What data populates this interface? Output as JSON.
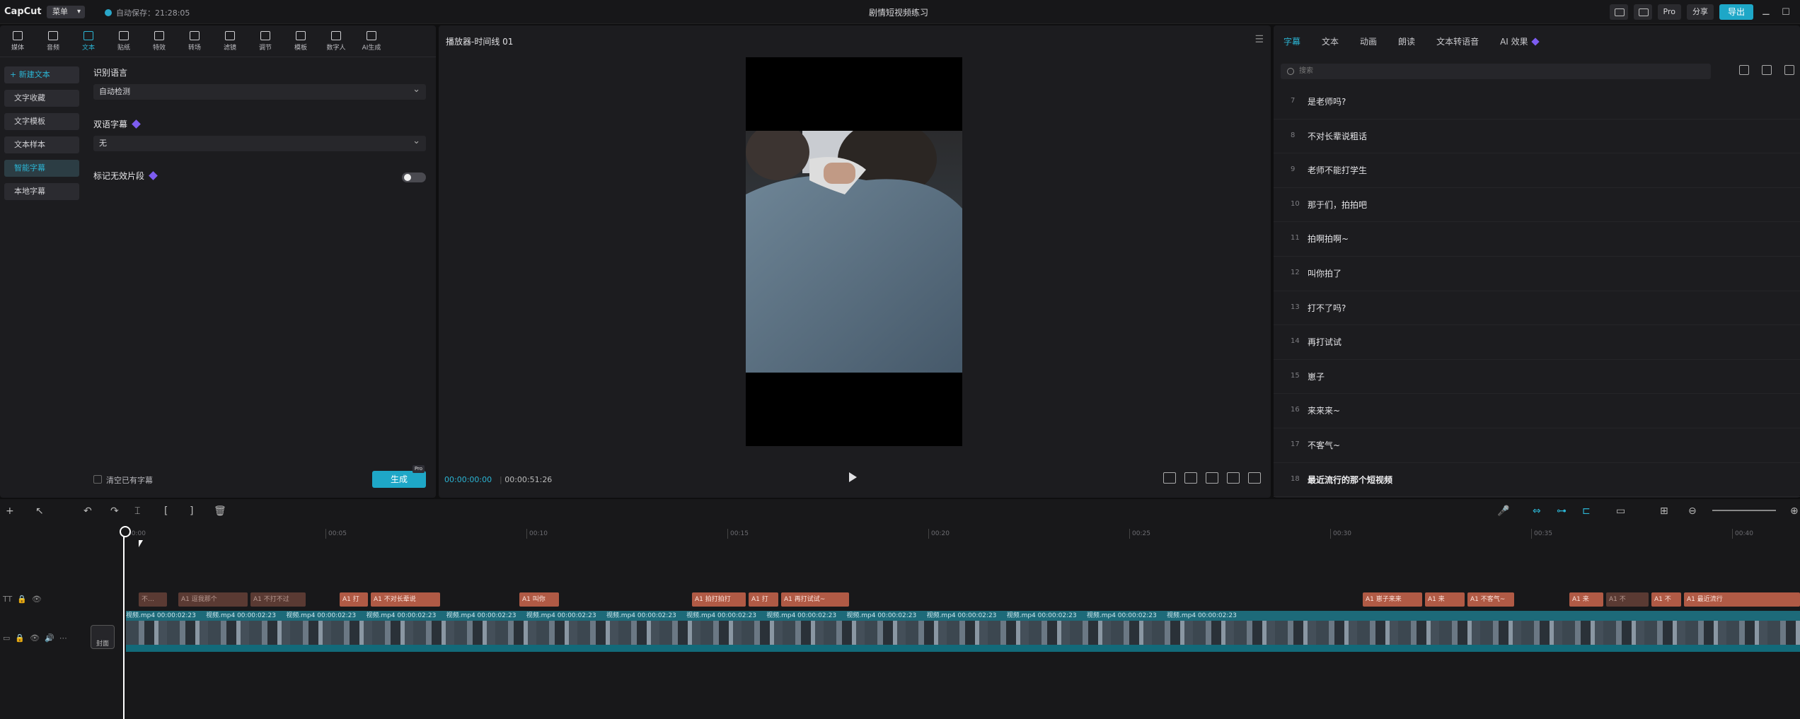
{
  "titlebar": {
    "logo": "CapCut",
    "menu": "菜单",
    "save_status": "自动保存：21:28:05",
    "project_title": "剧情短视频练习",
    "pro_label": "Pro",
    "share_label": "分享",
    "export_label": "导出"
  },
  "toolbar": {
    "tools": [
      {
        "label": "媒体"
      },
      {
        "label": "音频"
      },
      {
        "label": "文本"
      },
      {
        "label": "贴纸"
      },
      {
        "label": "特效"
      },
      {
        "label": "转场"
      },
      {
        "label": "滤镜"
      },
      {
        "label": "调节"
      },
      {
        "label": "模板"
      },
      {
        "label": "数字人"
      },
      {
        "label": "AI生成"
      }
    ]
  },
  "left_panel": {
    "side_items": [
      "+ 新建文本",
      "文字收藏",
      "文字模板",
      "文本样本",
      "智能字幕",
      "本地字幕"
    ],
    "recognize_language_label": "识别语言",
    "recognize_language_value": "自动检测",
    "bilingual_label": "双语字幕",
    "bilingual_value": "无",
    "mark_invalid_label": "标记无效片段",
    "clear_label": "清空已有字幕",
    "generate_label": "生成",
    "generate_badge": "Pro"
  },
  "player": {
    "title": "播放器-时间线 01",
    "time_current": "00:00:00:00",
    "time_total": "00:00:51:26"
  },
  "right_panel": {
    "tabs": [
      "字幕",
      "文本",
      "动画",
      "朗读",
      "文本转语音",
      "AI 效果"
    ],
    "search_placeholder": "搜索",
    "captions": [
      {
        "num": "7",
        "text": "是老师吗?"
      },
      {
        "num": "8",
        "text": "不对长辈说粗话"
      },
      {
        "num": "9",
        "text": "老师不能打学生"
      },
      {
        "num": "10",
        "text": "那于们，拍拍吧"
      },
      {
        "num": "11",
        "text": "拍啊拍啊~"
      },
      {
        "num": "12",
        "text": "叫你拍了"
      },
      {
        "num": "13",
        "text": "打不了吗?"
      },
      {
        "num": "14",
        "text": "再打试试"
      },
      {
        "num": "15",
        "text": "崽子"
      },
      {
        "num": "16",
        "text": "来来来~"
      },
      {
        "num": "17",
        "text": "不客气~"
      },
      {
        "num": "18",
        "text": "最近流行的那个短视频"
      }
    ]
  },
  "timeline": {
    "ruler": [
      "00:00",
      "00:05",
      "00:10",
      "00:15",
      "00:20",
      "00:25",
      "00:30",
      "00:35",
      "00:40"
    ],
    "cover_label": "封面",
    "text_clips": [
      {
        "label": "不…",
        "dim": true
      },
      {
        "label": "A1 逗我那个",
        "dim": false
      },
      {
        "label": "A1 不打不过",
        "dim": false
      },
      {
        "label": "A1 打",
        "dim": false
      },
      {
        "label": "A1 不对长辈说",
        "dim": false
      },
      {
        "label": "A1 叫你",
        "dim": false
      },
      {
        "label": "A1 拍打拍打",
        "dim": false
      },
      {
        "label": "A1 打",
        "dim": false
      },
      {
        "label": "A1 再打试试~",
        "dim": false
      },
      {
        "label": "A1 崽子来来",
        "dim": false
      },
      {
        "label": "A1 来",
        "dim": false
      },
      {
        "label": "A1 不客气~",
        "dim": false
      },
      {
        "label": "A1 来",
        "dim": false
      },
      {
        "label": "A1 不",
        "dim": true
      },
      {
        "label": "A1 不",
        "dim": false
      },
      {
        "label": "A1 最近流行",
        "dim": false
      }
    ],
    "video_label": "视频.mp4  00:00:02:23"
  },
  "colors": {
    "accent": "#1ea7c7",
    "text_clip": "#b05a45",
    "video_clip": "#1d6a79"
  }
}
